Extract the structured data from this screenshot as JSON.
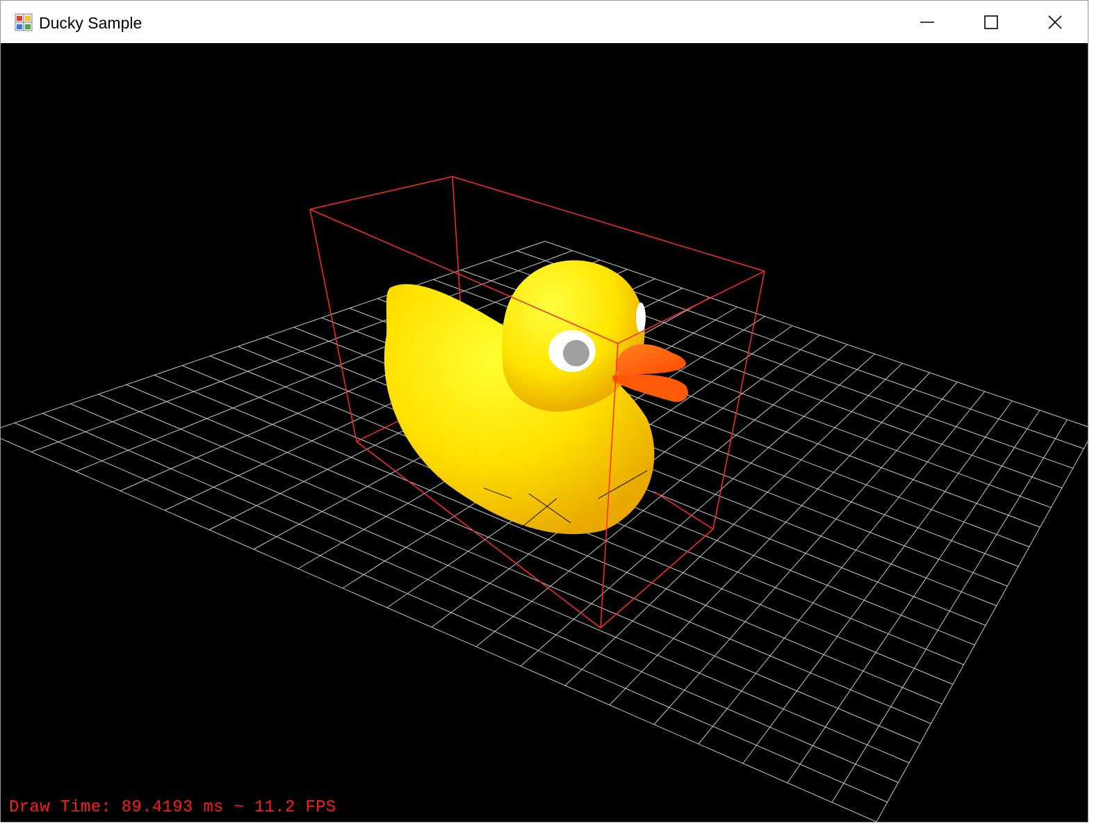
{
  "window": {
    "title": "Ducky Sample",
    "app_icon": "windows-forms-app-icon",
    "controls": {
      "minimize_icon": "minimize-icon",
      "maximize_icon": "maximize-icon",
      "close_icon": "close-icon"
    }
  },
  "viewport": {
    "background_color": "#000000",
    "grid_color": "#c8c8c8",
    "bounding_box_color": "#ff2a2a",
    "duck_body_color": "#ffee00",
    "duck_beak_color": "#ff6a10",
    "duck_eye_color": "#ffffff",
    "duck_pupil_color": "#a0a0a0"
  },
  "status": {
    "text": "Draw Time: 89.4193 ms ~ 11.2 FPS",
    "color": "#ff1a1a"
  }
}
